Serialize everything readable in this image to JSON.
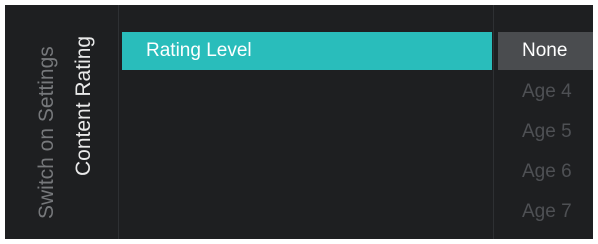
{
  "breadcrumb": {
    "parent": "Switch on Settings",
    "current": "Content Rating"
  },
  "menu": {
    "items": [
      {
        "label": "Rating Level",
        "selected": true
      }
    ]
  },
  "options": {
    "items": [
      {
        "label": "None",
        "highlighted": true
      },
      {
        "label": "Age 4",
        "highlighted": false
      },
      {
        "label": "Age 5",
        "highlighted": false
      },
      {
        "label": "Age 6",
        "highlighted": false
      },
      {
        "label": "Age 7",
        "highlighted": false
      }
    ]
  },
  "colors": {
    "accent": "#29bdbb",
    "background": "#1e1f21",
    "highlight": "#4a4c4f"
  }
}
